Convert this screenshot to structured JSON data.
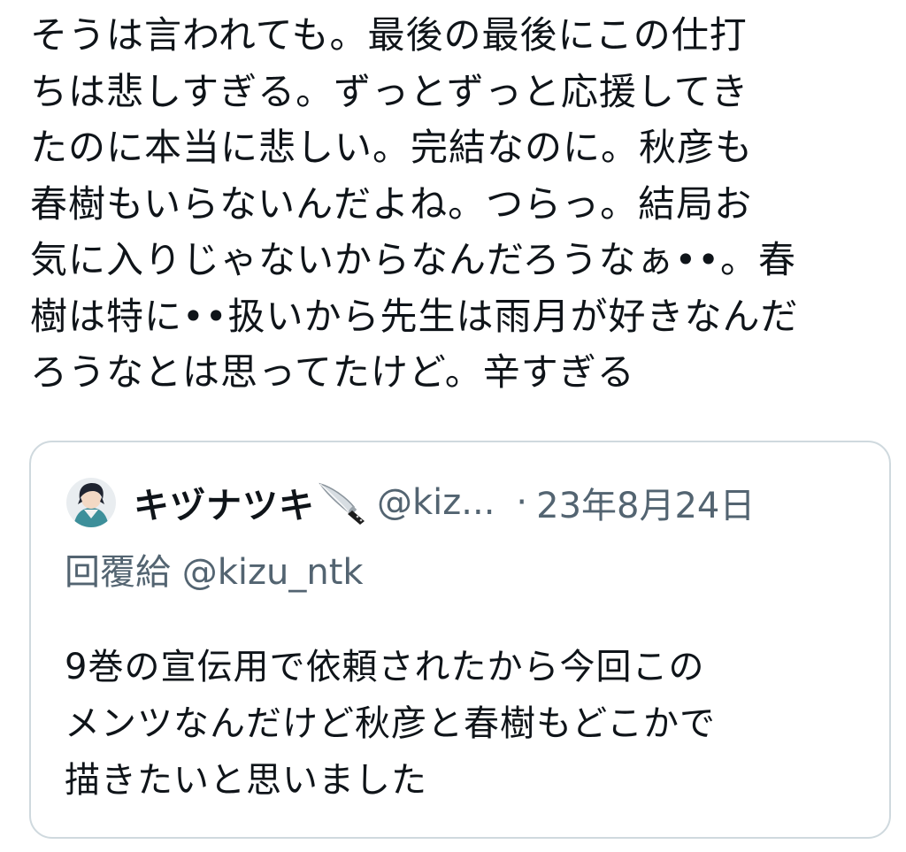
{
  "tweet": {
    "text_lines": [
      "そうは言われても。最後の最後にこの仕打",
      "ちは悲しすぎる。ずっとずっと応援してき",
      "たのに本当に悲しい。完結なのに。秋彦も",
      "春樹もいらないんだよね。つらっ。結局お",
      "気に入りじゃないからなんだろうなぁ••。春",
      "樹は特に••扱いから先生は雨月が好きなんだ",
      "ろうなとは思ってたけど。辛すぎる"
    ]
  },
  "quoted_tweet": {
    "display_name": "キヅナツキ",
    "name_emoji_icon": "kitchen-knife-icon",
    "handle": "@kiz...",
    "separator": "·",
    "date": "23年8月24日",
    "reply_prefix": "回覆給",
    "reply_to": "@kizu_ntk",
    "text_lines": [
      "9巻の宣伝用で依頼されたから今回この",
      "メンツなんだけど秋彦と春樹もどこかで",
      "描きたいと思いました"
    ]
  },
  "colors": {
    "text_primary": "#0f1419",
    "text_secondary": "#536471",
    "card_border": "#cfd9de",
    "background": "#ffffff"
  }
}
